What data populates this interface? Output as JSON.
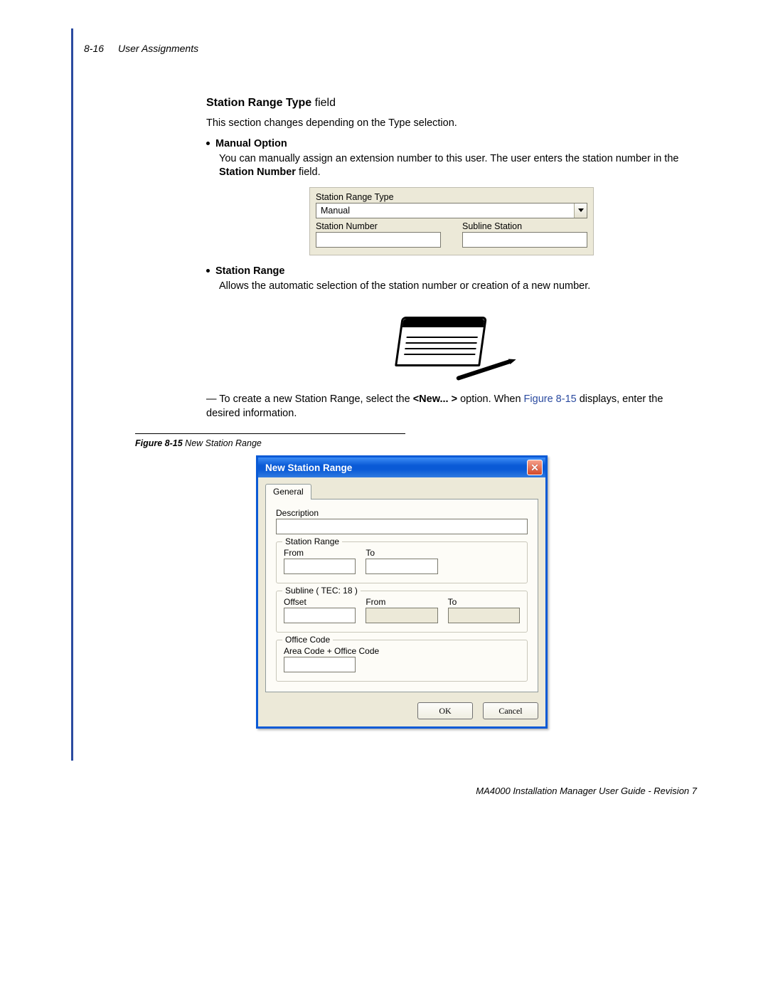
{
  "header": {
    "page_label": "8-16",
    "section_title": "User Assignments"
  },
  "section_heading": {
    "bold": "Station Range Type",
    "rest": " field"
  },
  "intro_text": "This section changes depending on the Type selection.",
  "bullets": {
    "manual": {
      "title": "Manual Option",
      "text_a": "You can manually assign an extension number to this user. The user enters the station number in the ",
      "text_bold": "Station Number",
      "text_b": " field."
    },
    "station_range": {
      "title": "Station Range",
      "text": "Allows the automatic selection of the station number or creation of a new number."
    }
  },
  "panel1": {
    "label_type": "Station Range Type",
    "select_value": "Manual",
    "label_station_number": "Station Number",
    "label_subline_station": "Subline Station"
  },
  "dash_line": {
    "a": "— To create a new Station Range, select the ",
    "bold": "<New... >",
    "b": " option. When ",
    "link": "Figure 8-15",
    "c": " displays, enter the desired information."
  },
  "figure": {
    "label": "Figure 8-15",
    "caption": "  New Station Range"
  },
  "dialog": {
    "title": "New Station Range",
    "tab": "General",
    "description_label": "Description",
    "group_station_range": {
      "legend": "Station Range",
      "from": "From",
      "to": "To"
    },
    "group_subline": {
      "legend": "Subline ( TEC: 18 )",
      "offset": "Offset",
      "from": "From",
      "to": "To"
    },
    "group_office": {
      "legend": "Office Code",
      "area_office": "Area Code + Office Code"
    },
    "buttons": {
      "ok": "OK",
      "cancel": "Cancel"
    }
  },
  "footer": "MA4000 Installation Manager User Guide - Revision 7"
}
